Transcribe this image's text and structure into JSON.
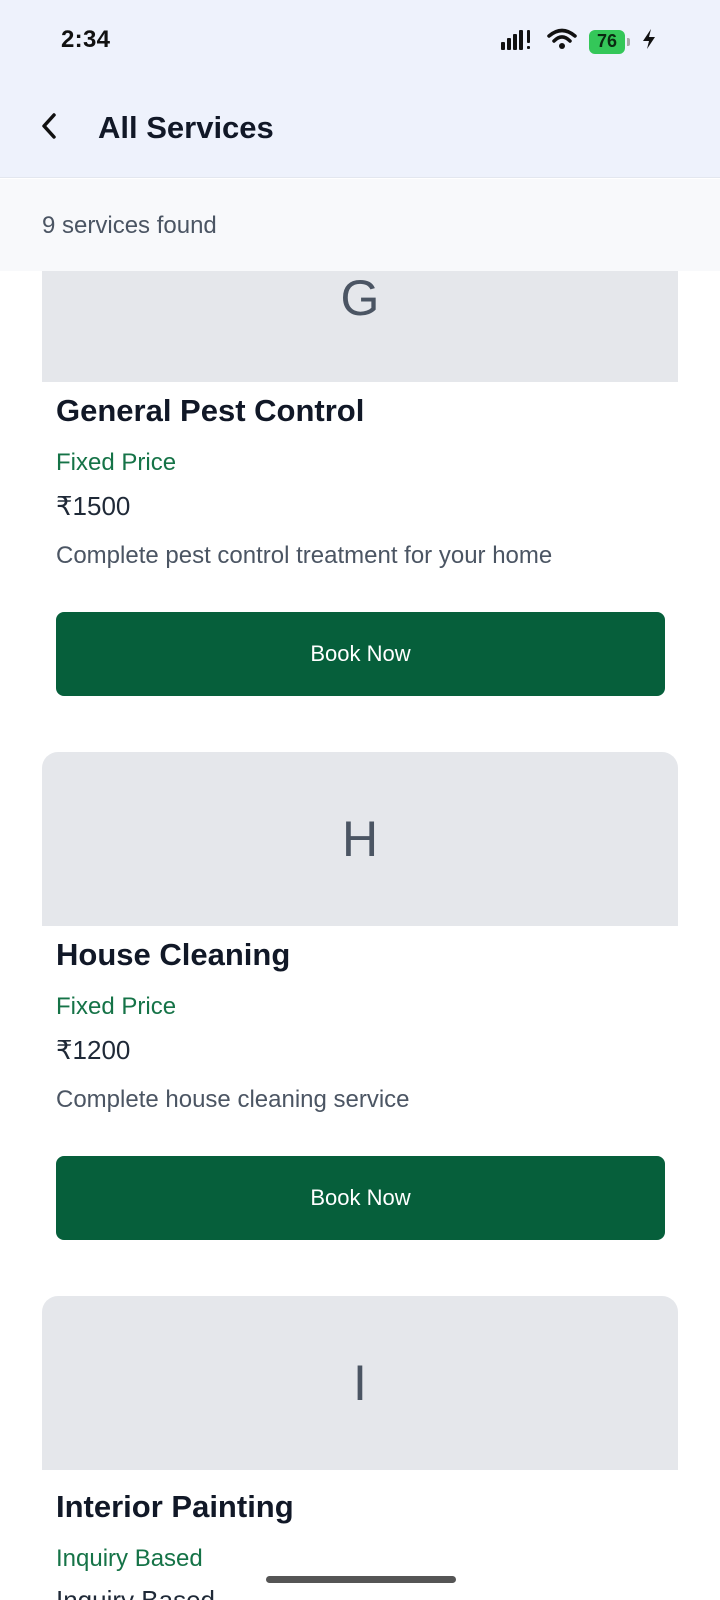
{
  "status_bar": {
    "time": "2:34",
    "battery": "76"
  },
  "header": {
    "title": "All Services"
  },
  "results": {
    "count_text": "9 services found"
  },
  "services": [
    {
      "letter": "G",
      "name": "General Pest Control",
      "pricing_type": "Fixed Price",
      "price": "₹1500",
      "description": "Complete pest control treatment for your home",
      "button_label": "Book Now"
    },
    {
      "letter": "H",
      "name": "House Cleaning",
      "pricing_type": "Fixed Price",
      "price": "₹1200",
      "description": "Complete house cleaning service",
      "button_label": "Book Now"
    },
    {
      "letter": "I",
      "name": "Interior Painting",
      "pricing_type": "Inquiry Based",
      "price": "Inquiry Based"
    }
  ],
  "colors": {
    "header_bg": "#eef2fc",
    "accent_green": "#065f3b",
    "pricing_green": "#157347",
    "banner_gray": "#e5e7eb"
  }
}
